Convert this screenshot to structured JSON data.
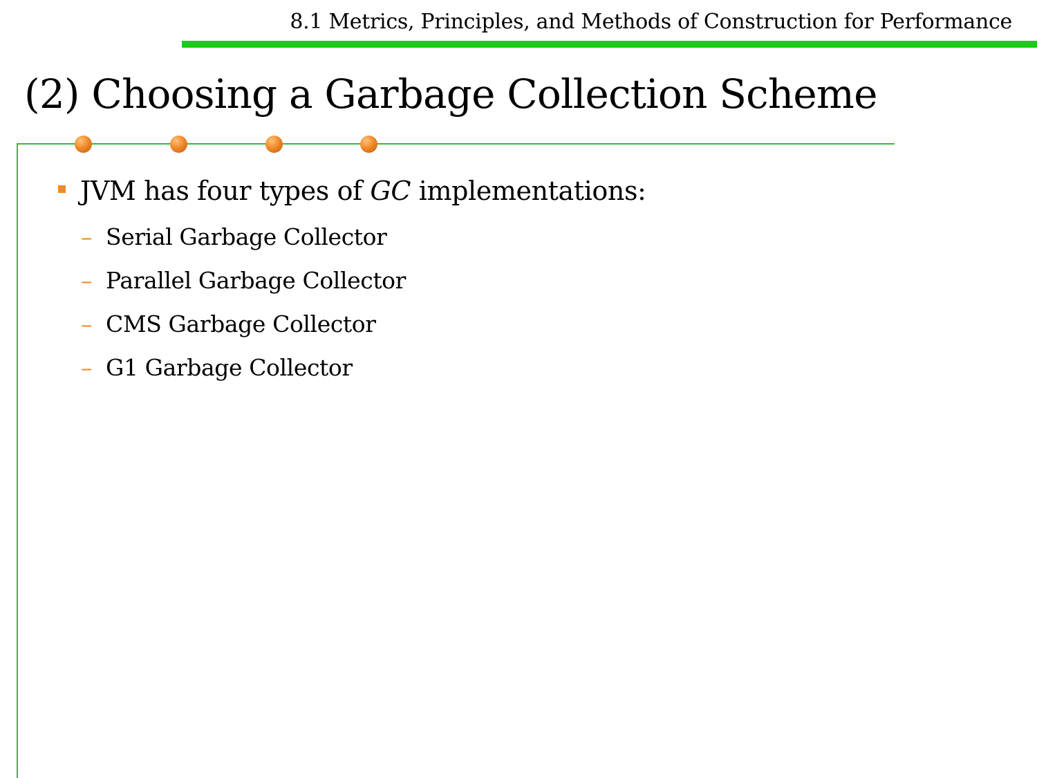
{
  "header": {
    "section_title": "8.1 Metrics, Principles, and Methods of Construction for Performance"
  },
  "slide": {
    "title": "(2) Choosing a Garbage Collection Scheme"
  },
  "content": {
    "bullet_prefix": "JVM has four types of ",
    "bullet_emphasis": "GC",
    "bullet_suffix": " implementations:",
    "dash_glyph": "–",
    "sub_items": [
      "Serial Garbage Collector",
      "Parallel Garbage Collector",
      "CMS Garbage Collector",
      "G1 Garbage Collector"
    ]
  },
  "colors": {
    "accent_green": "#1fc81f",
    "accent_orange": "#f08a2a"
  }
}
